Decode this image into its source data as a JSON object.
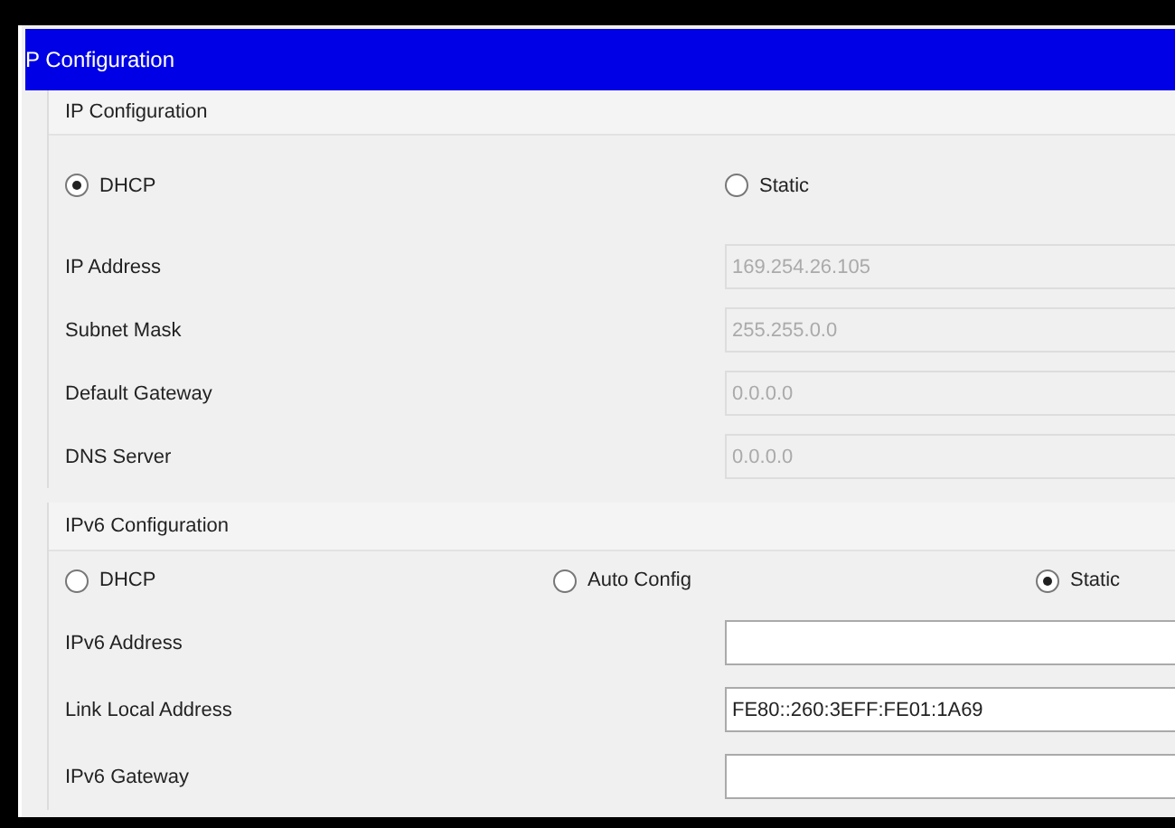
{
  "window": {
    "title": "P Configuration"
  },
  "sections": [
    {
      "title": "IP Configuration",
      "modes": [
        {
          "label": "DHCP",
          "selected": true
        },
        {
          "label": "Static",
          "selected": false
        }
      ],
      "fields": [
        {
          "label": "IP Address",
          "value": "169.254.26.105",
          "disabled": true
        },
        {
          "label": "Subnet Mask",
          "value": "255.255.0.0",
          "disabled": true
        },
        {
          "label": "Default Gateway",
          "value": "0.0.0.0",
          "disabled": true
        },
        {
          "label": "DNS Server",
          "value": "0.0.0.0",
          "disabled": true
        }
      ]
    },
    {
      "title": "IPv6 Configuration",
      "modes": [
        {
          "label": "DHCP",
          "selected": false
        },
        {
          "label": "Auto Config",
          "selected": false
        },
        {
          "label": "Static",
          "selected": true
        }
      ],
      "fields": [
        {
          "label": "IPv6 Address",
          "disabled": false
        },
        {
          "label": "Link Local Address",
          "value": "FE80::260:3EFF:FE01:1A69",
          "disabled": false
        },
        {
          "label": "IPv6 Gateway",
          "disabled": false
        }
      ]
    }
  ]
}
